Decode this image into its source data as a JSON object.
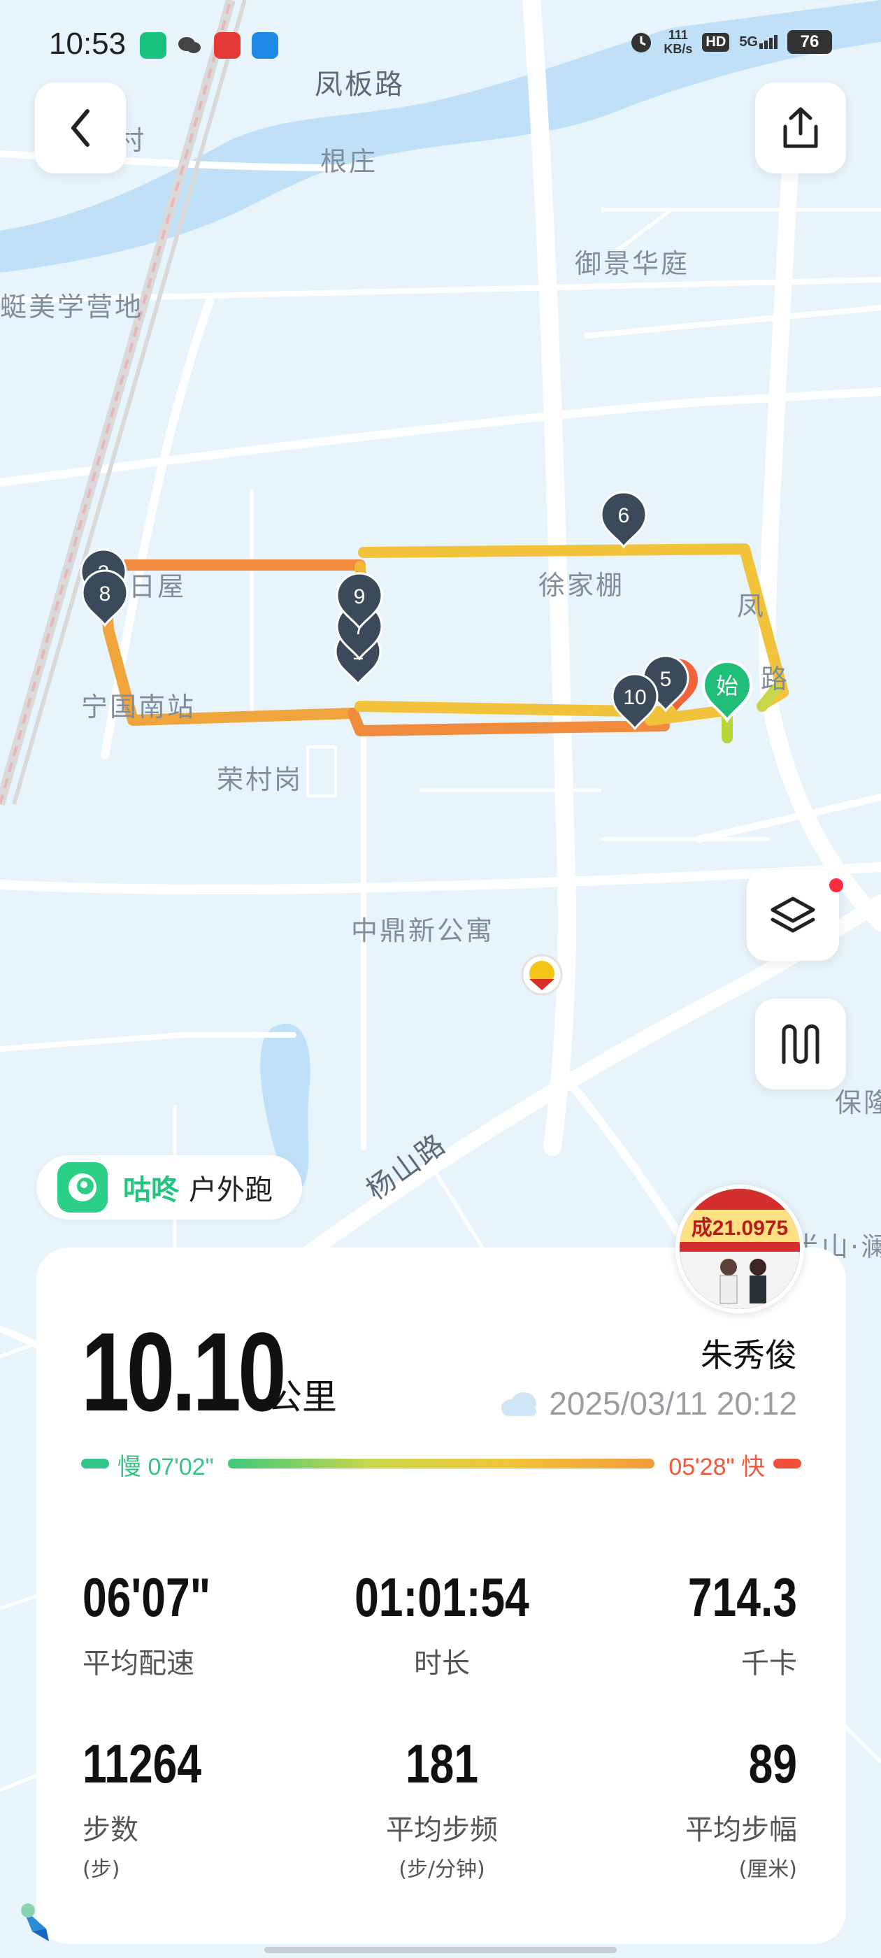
{
  "status_bar": {
    "time": "10:53",
    "network_speed_value": "111",
    "network_speed_unit": "KB/s",
    "hd": "HD",
    "signal": "5G",
    "battery": "76"
  },
  "map": {
    "labels": {
      "fengban_road": "凤板路",
      "genzhuang": "根庄",
      "cun": "村",
      "yujing": "御景华庭",
      "camp": "蜓美学营地",
      "xujiapeng": "徐家棚",
      "riwu": "日屋",
      "ningguo": "宁国南站",
      "rongcun": "荣村岗",
      "zhongding": "中鼎新公寓",
      "yangshan_road": "杨山路",
      "baolong": "保隆",
      "feng_road": "凤",
      "lu": "路",
      "shanlan": "半山·澜"
    },
    "markers": [
      "6",
      "9",
      "7",
      "8",
      "10",
      "5",
      "3",
      "1"
    ],
    "start_marker": "始",
    "route_colors": {
      "fast": "#f0883a",
      "mid": "#f1c33b",
      "slow": "#b7d63a"
    }
  },
  "brand": {
    "name": "咕咚",
    "activity": "户外跑"
  },
  "summary": {
    "distance": "10.10",
    "distance_unit": "公里",
    "user_name": "朱秀俊",
    "datetime": "2025/03/11 20:12",
    "weather_icon": "cloud-icon",
    "pace_slow_label": "慢 07'02\"",
    "pace_fast_label": "05'28\" 快"
  },
  "stats": [
    {
      "value": "06'07\"",
      "label": "平均配速",
      "unit": ""
    },
    {
      "value": "01:01:54",
      "label": "时长",
      "unit": ""
    },
    {
      "value": "714.3",
      "label": "千卡",
      "unit": ""
    },
    {
      "value": "11264",
      "label": "步数",
      "unit": "(步)"
    },
    {
      "value": "181",
      "label": "平均步频",
      "unit": "(步/分钟)"
    },
    {
      "value": "89",
      "label": "平均步幅",
      "unit": "(厘米)"
    }
  ],
  "avatar_text": "成21.0975",
  "colors": {
    "accent": "#22c57e",
    "card": "#ffffff",
    "map_bg": "#e8f4fb",
    "water": "#bfe0f7"
  }
}
